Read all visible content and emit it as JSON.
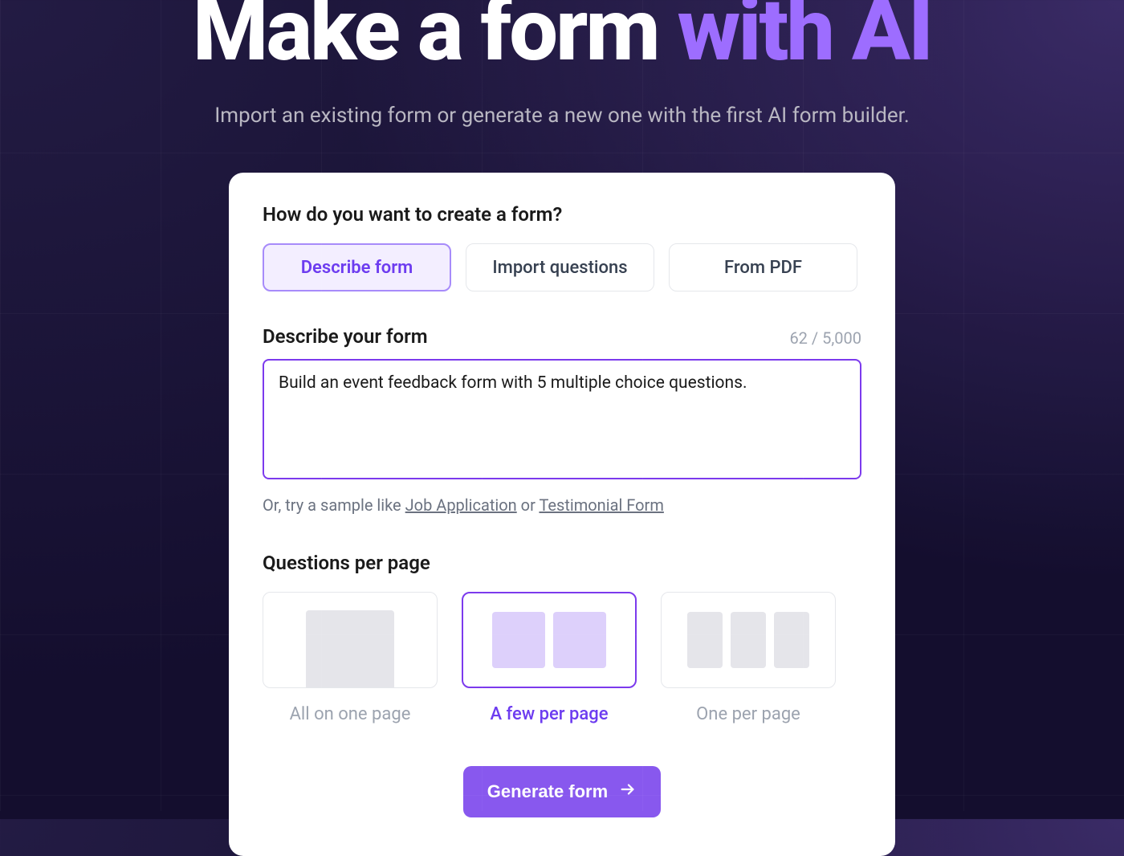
{
  "hero": {
    "title_plain": "Make a form ",
    "title_accent": "with AI",
    "subtitle": "Import an existing form or generate a new one with the first AI form builder."
  },
  "card": {
    "create_prompt": "How do you want to create a form?",
    "tabs": {
      "describe": "Describe form",
      "import": "Import questions",
      "pdf": "From PDF"
    },
    "describe_label": "Describe your form",
    "char_count": "62 / 5,000",
    "textarea_value": "Build an event feedback form with 5 multiple choice questions.",
    "hint_prefix": "Or, try a sample like ",
    "hint_link1": "Job Application",
    "hint_sep": " or ",
    "hint_link2": "Testimonial Form",
    "qpp_label": "Questions per page",
    "layouts": {
      "all": "All on one page",
      "few": "A few per page",
      "one": "One per page"
    },
    "cta": "Generate form"
  }
}
